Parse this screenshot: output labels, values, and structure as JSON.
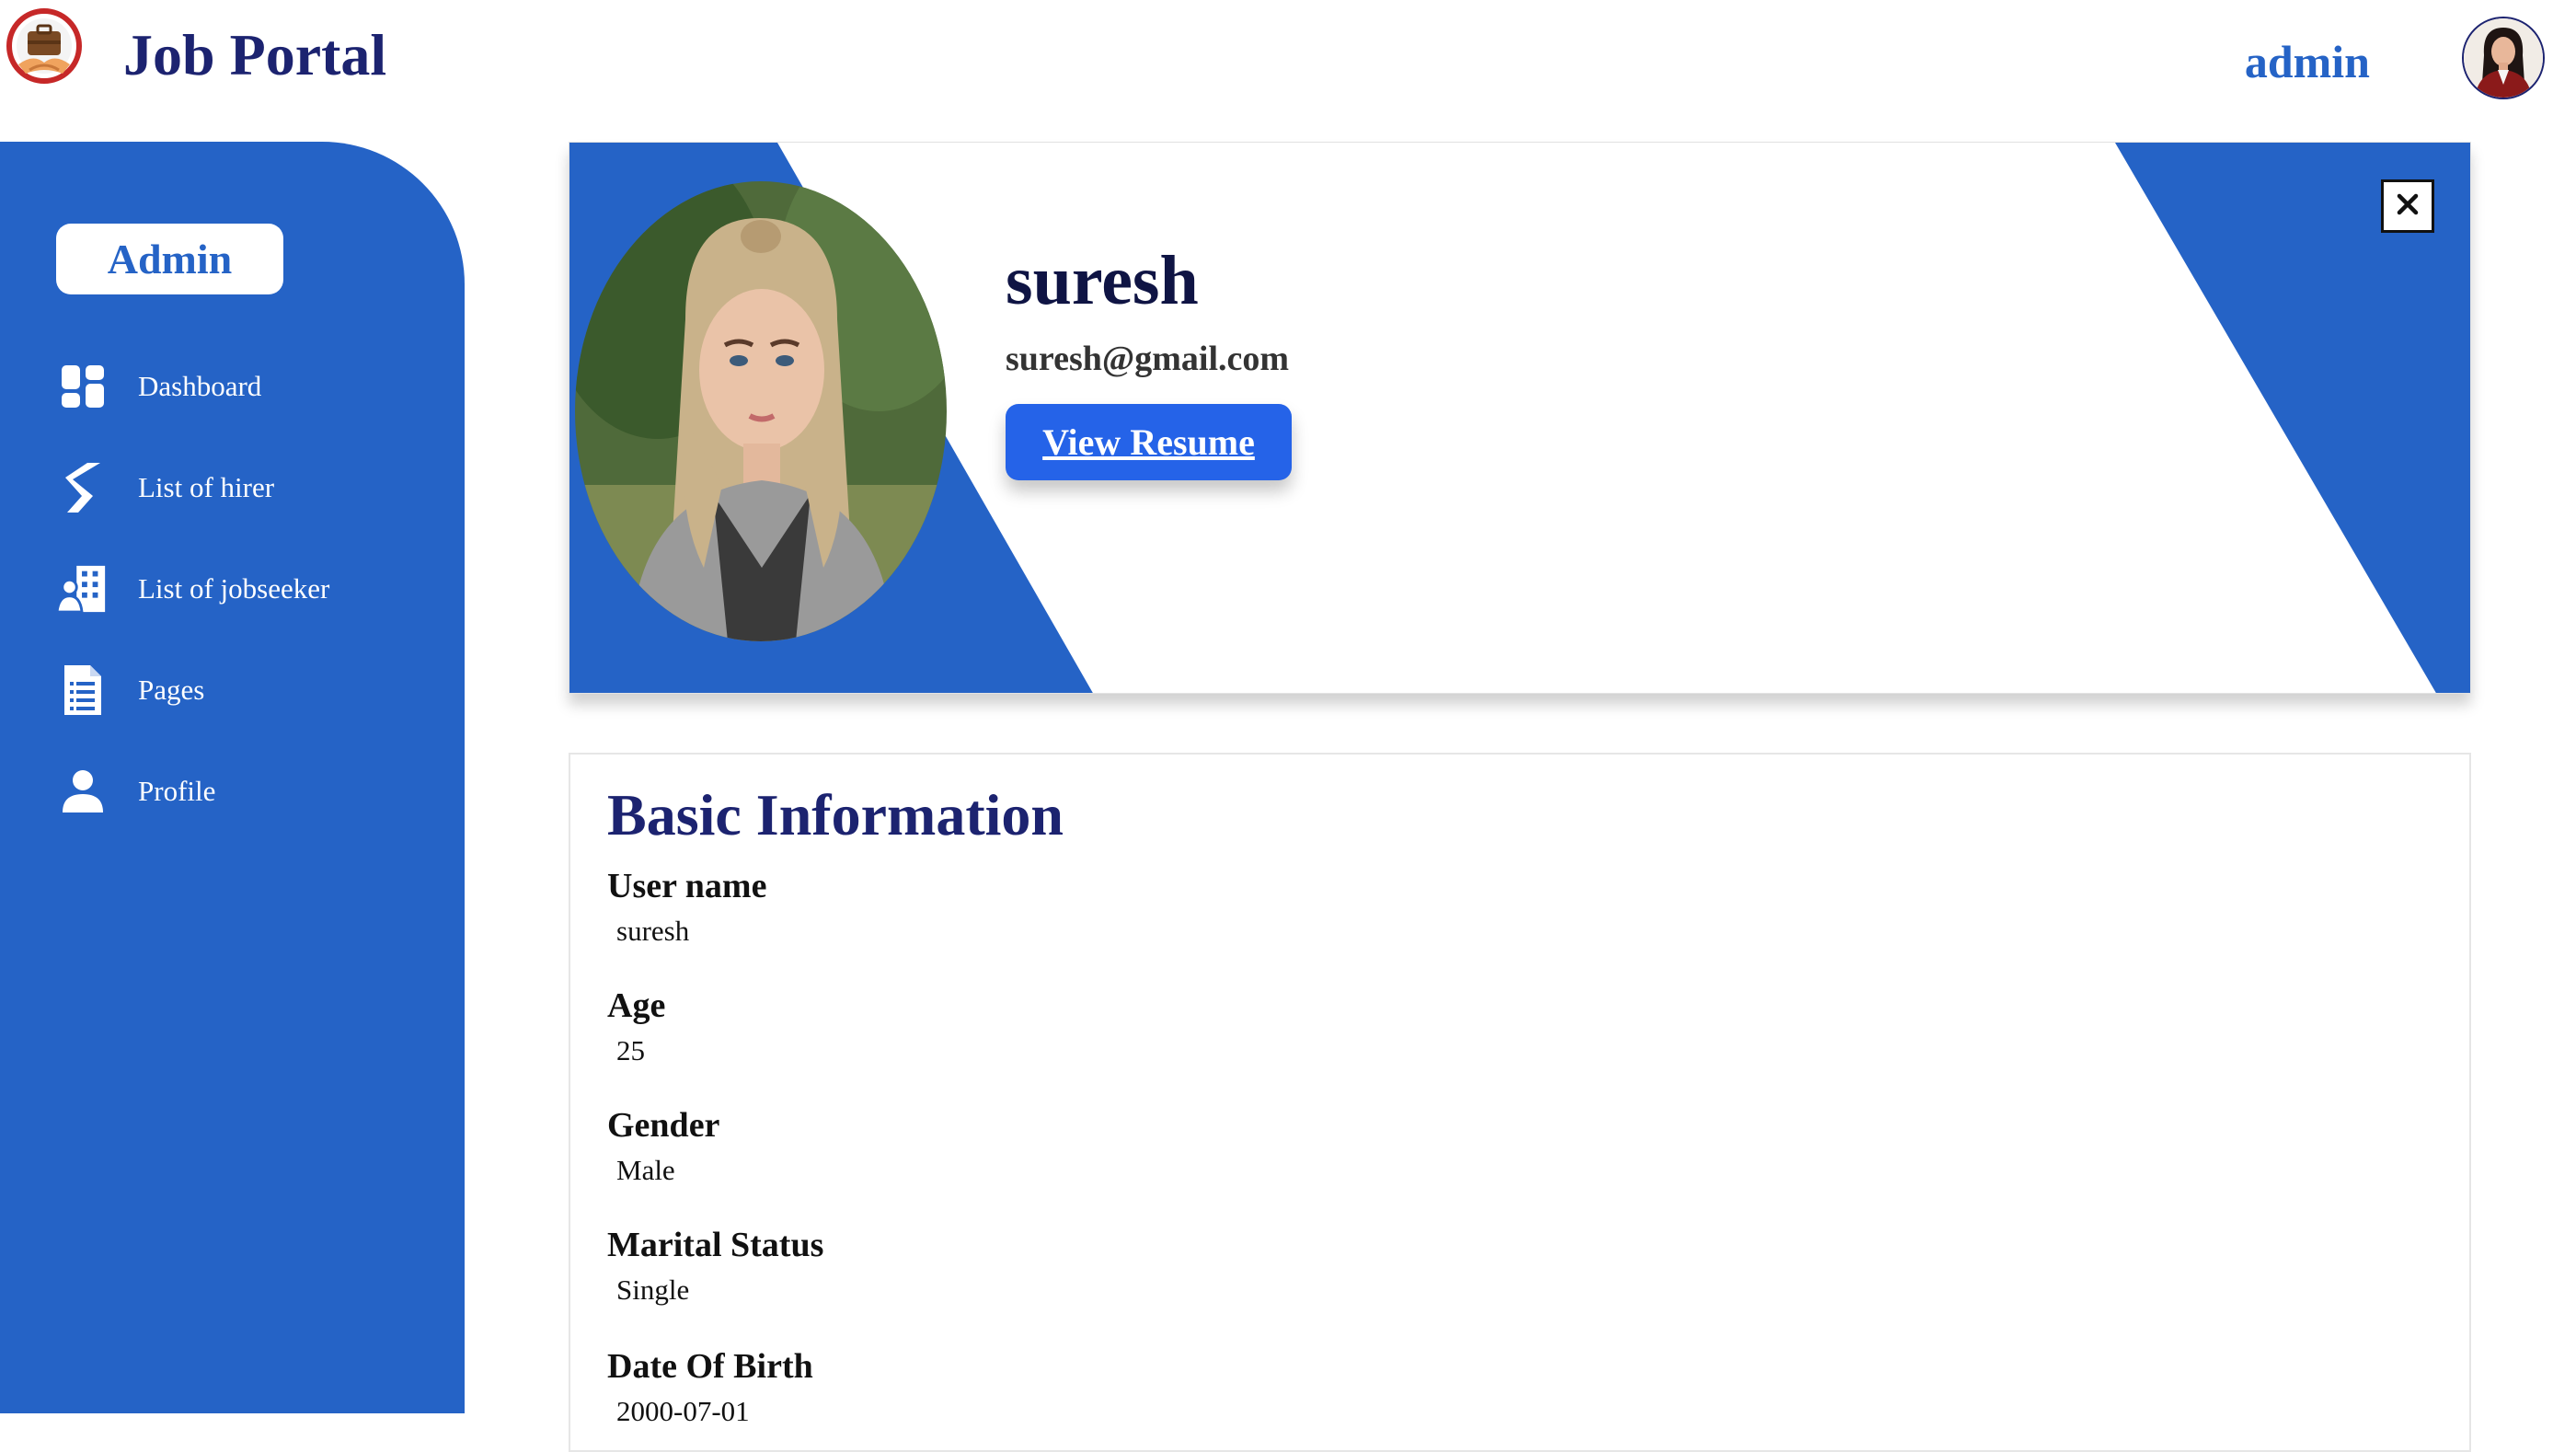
{
  "header": {
    "app_title": "Job Portal",
    "logo_icon": "briefcase-handshake-logo",
    "user_name": "admin",
    "avatar_icon": "user-avatar"
  },
  "sidebar": {
    "role_badge": "Admin",
    "items": [
      {
        "label": "Dashboard",
        "icon": "dashboard-icon"
      },
      {
        "label": "List of hirer",
        "icon": "hirer-icon"
      },
      {
        "label": "List of jobseeker",
        "icon": "jobseeker-icon"
      },
      {
        "label": "Pages",
        "icon": "document-icon"
      },
      {
        "label": "Profile",
        "icon": "person-icon"
      }
    ]
  },
  "profile": {
    "name": "suresh",
    "email": "suresh@gmail.com",
    "resume_button": "View Resume",
    "close_icon": "close-icon"
  },
  "basic_info": {
    "title": "Basic Information",
    "fields": [
      {
        "label": "User name",
        "value": "suresh"
      },
      {
        "label": "Age",
        "value": "25"
      },
      {
        "label": "Gender",
        "value": "Male"
      },
      {
        "label": "Marital Status",
        "value": "Single"
      },
      {
        "label": "Date Of Birth",
        "value": "2000-07-01"
      }
    ]
  },
  "colors": {
    "primary_blue": "#2563c6",
    "navy": "#1c2370",
    "button_blue": "#2563e8"
  }
}
